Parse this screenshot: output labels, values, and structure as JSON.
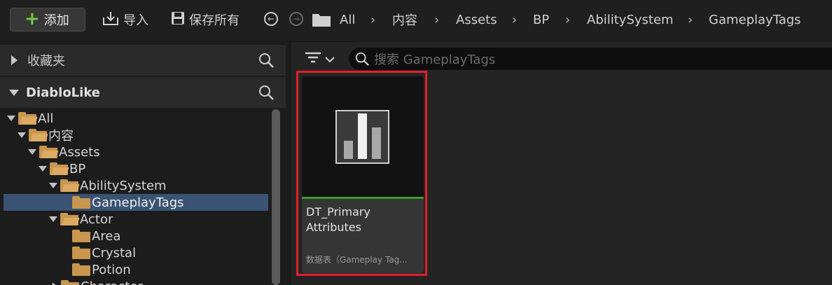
{
  "toolbar": {
    "add_label": "添加",
    "import_label": "导入",
    "save_all_label": "保存所有"
  },
  "breadcrumb": [
    "All",
    "内容",
    "Assets",
    "BP",
    "AbilitySystem",
    "GameplayTags"
  ],
  "left_panel": {
    "favorites_label": "收藏夹",
    "project_label": "DiabloLike",
    "tree": [
      {
        "label": "All"
      },
      {
        "label": "内容"
      },
      {
        "label": "Assets"
      },
      {
        "label": "BP"
      },
      {
        "label": "AbilitySystem"
      },
      {
        "label": "GameplayTags",
        "selected": true
      },
      {
        "label": "Actor"
      },
      {
        "label": "Area"
      },
      {
        "label": "Crystal"
      },
      {
        "label": "Potion"
      },
      {
        "label": "Character"
      }
    ]
  },
  "search": {
    "placeholder": "搜索 GameplayTags"
  },
  "asset": {
    "name_line1": "DT_Primary",
    "name_line2": "Attributes",
    "type_label": "数据表（Gameplay Tag..."
  },
  "colors": {
    "selection": "#3a5373",
    "highlight_border": "#e0202a",
    "asset_type_bar": "#3d9a2c",
    "folder": "#c8964f",
    "add_icon": "#6fcb3c"
  },
  "icons": [
    "plus-icon",
    "import-icon",
    "save-icon",
    "back-icon",
    "forward-icon",
    "folder-icon",
    "chevron-right-icon",
    "search-icon",
    "filter-icon",
    "chevron-down-icon",
    "data-table-icon"
  ]
}
